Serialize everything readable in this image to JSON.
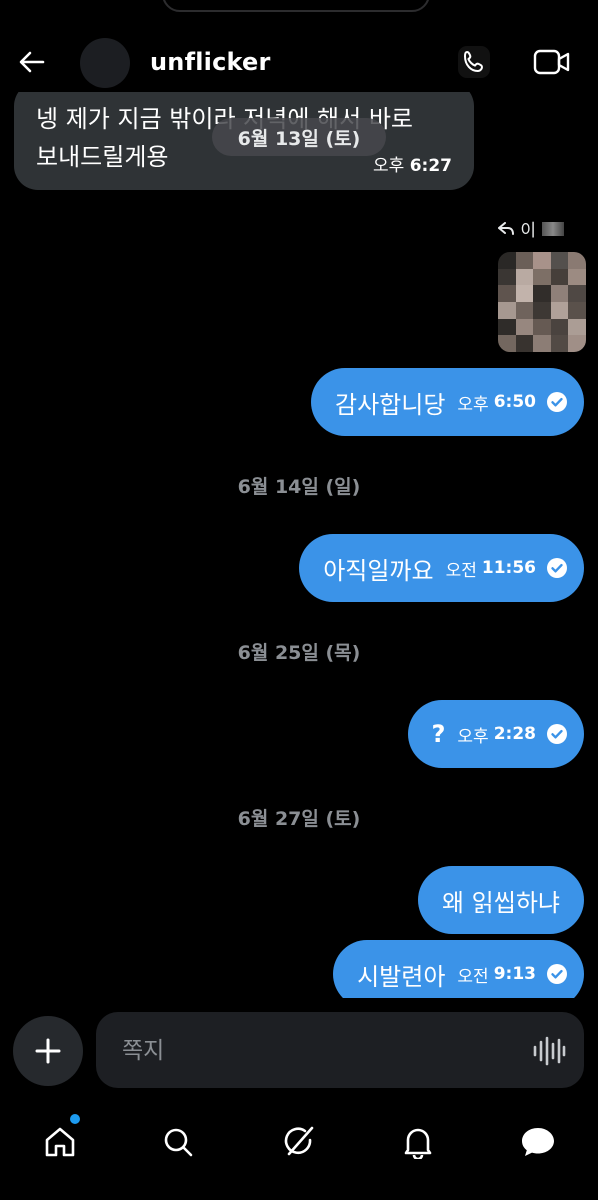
{
  "header": {
    "username": "unflicker"
  },
  "messages": {
    "incoming": {
      "text": "넹 제가 지금 밖이라 저녁에 해서 바로\n보내드릴게용",
      "time_prefix": "오후",
      "time": "6:27"
    },
    "floating_date": "6월 13일 (토)",
    "reply_tag": "이",
    "outgoing": [
      {
        "text": "감사합니당",
        "time_prefix": "오후",
        "time": "6:50"
      },
      {
        "text": "아직일까요",
        "time_prefix": "오전",
        "time": "11:56"
      },
      {
        "text": "?",
        "time_prefix": "오후",
        "time": "2:28"
      },
      {
        "text": "왜 읽씹하냐"
      },
      {
        "text": "시발련아",
        "time_prefix": "오전",
        "time": "9:13"
      }
    ],
    "date_separators": [
      "6월 14일 (일)",
      "6월 25일 (목)",
      "6월 27일 (토)"
    ]
  },
  "composer": {
    "placeholder": "쪽지"
  },
  "colors": {
    "background": "#000000",
    "outgoing_bubble": "#3b93e8",
    "incoming_bubble": "#2f3336",
    "notification_dot": "#1d9bf0"
  },
  "icons": {
    "back": "arrow-left-icon",
    "call": "phone-icon",
    "video": "video-camera-icon",
    "add": "plus-icon",
    "voice": "waveform-icon",
    "nav": [
      "home-icon",
      "search-icon",
      "grok-icon",
      "bell-icon",
      "messages-icon"
    ]
  }
}
